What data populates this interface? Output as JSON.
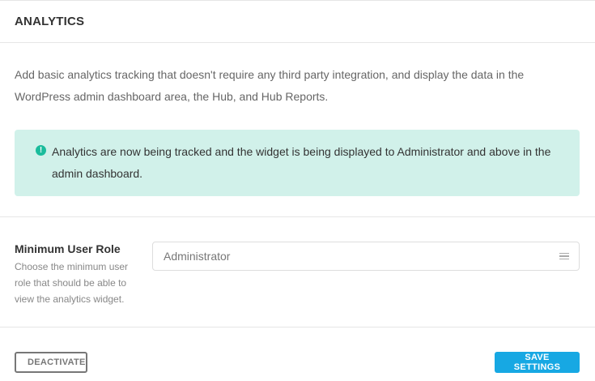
{
  "header": {
    "title": "ANALYTICS"
  },
  "body": {
    "description": "Add basic analytics tracking that doesn't require any third party integration, and display the data in the WordPress admin dashboard area, the Hub, and Hub Reports."
  },
  "notice": {
    "icon": "info-icon",
    "icon_glyph": "!",
    "text": "Analytics are now being tracked and the widget is being displayed to Administrator and above in the admin dashboard.",
    "color": "#d1f1ea",
    "icon_color": "#1abc9c"
  },
  "settings": {
    "min_role": {
      "label": "Minimum User Role",
      "help": "Choose the minimum user role that should be able to view the analytics widget.",
      "selected": "Administrator",
      "icon": "menu-lines-icon"
    }
  },
  "footer": {
    "deactivate_label": "DEACTIVATE",
    "save_label": "SAVE SETTINGS",
    "primary_color": "#17a8e3"
  }
}
